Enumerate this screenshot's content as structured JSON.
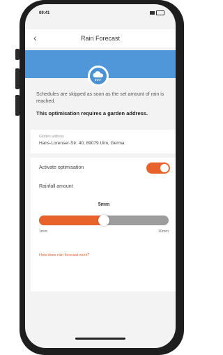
{
  "status_bar": {
    "time": "09:41"
  },
  "nav": {
    "back_icon": "chevron-left-icon",
    "back_glyph": "‹",
    "title": "Rain Forecast"
  },
  "banner": {
    "color": "#4f97d9",
    "icon": "rain-cloud-icon"
  },
  "description": "Schedules are skipped as soon as the set amount of rain is reached.",
  "address_note": "This optimisation requires a garden address.",
  "address": {
    "label": "Garden address",
    "value": "Hans-Lorenser-Str. 40, 89079 Ulm, Germa"
  },
  "optimisation": {
    "label": "Activate optimisation",
    "enabled": true,
    "accent": "#e8622c"
  },
  "rainfall": {
    "label": "Rainfall amount",
    "value_text": "5mm",
    "min_label": "1mm",
    "max_label": "10mm",
    "value_fraction": 0.5
  },
  "help_link": "How does rain forecast work?"
}
